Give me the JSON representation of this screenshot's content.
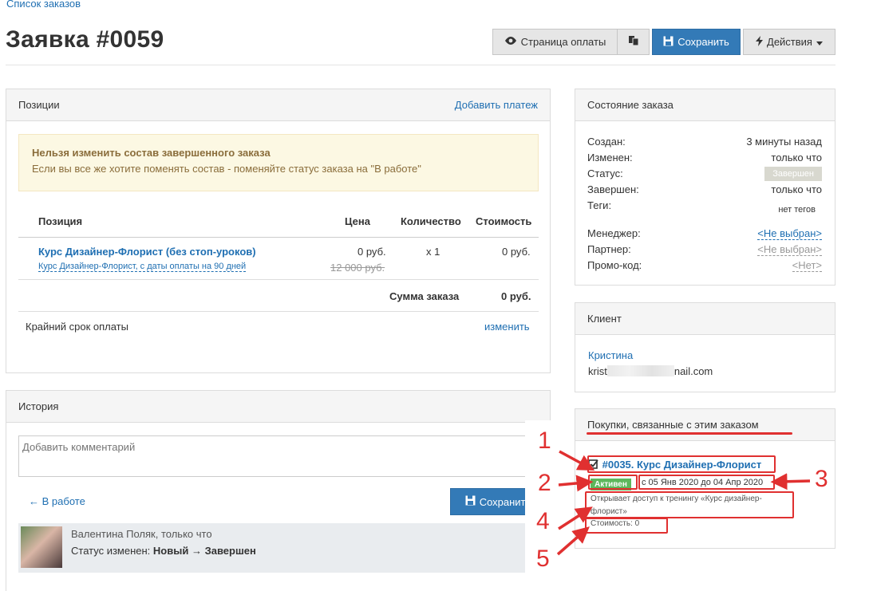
{
  "breadcrumb": "Список заказов",
  "title": "Заявка #0059",
  "toolbar": {
    "payment_page": "Страница оплаты",
    "save": "Сохранить",
    "actions": "Действия"
  },
  "positions": {
    "header": "Позиции",
    "add_payment": "Добавить платеж",
    "alert_title": "Нельзя изменить состав завершенного заказа",
    "alert_text": "Если вы все же хотите поменять состав - поменяйте статус заказа на \"В работе\"",
    "columns": {
      "position": "Позиция",
      "price": "Цена",
      "quantity": "Количество",
      "cost": "Стоимость"
    },
    "item": {
      "name": "Курс Дизайнер-Флорист (без стоп-уроков)",
      "sub": "Курс Дизайнер-Флорист, с даты оплаты на 90 дней",
      "price": "0 руб.",
      "old_price": "12 000 руб.",
      "qty": "x 1",
      "cost": "0 руб."
    },
    "total_label": "Сумма заказа",
    "total_value": "0 руб.",
    "deadline_label": "Крайний срок оплаты",
    "deadline_change": "изменить"
  },
  "history": {
    "header": "История",
    "comment_placeholder": "Добавить комментарий",
    "in_work": "В работе",
    "save": "Сохранить",
    "entry_author": "Валентина Поляк",
    "entry_time": ", только что",
    "entry_status_prefix": "Статус изменен: ",
    "entry_status_from": "Новый",
    "entry_status_to": "Завершен"
  },
  "order_state": {
    "header": "Состояние заказа",
    "created_label": "Создан:",
    "created_value": "3 минуты назад",
    "changed_label": "Изменен:",
    "changed_value": "только что",
    "status_label": "Статус:",
    "status_value": "Завершен",
    "completed_label": "Завершен:",
    "completed_value": "только что",
    "tags_label": "Теги:",
    "tags_value": "нет тегов",
    "manager_label": "Менеджер:",
    "manager_value": "<Не выбран>",
    "partner_label": "Партнер:",
    "partner_value": "<Не выбран>",
    "promo_label": "Промо-код:",
    "promo_value": "<Нет>"
  },
  "client": {
    "header": "Клиент",
    "name": "Кристина",
    "email_start": "krist",
    "email_end": "nail.com"
  },
  "purchases": {
    "header": "Покупки, связанные с этим заказом",
    "title": "#0035. Курс Дизайнер-Флорист",
    "badge": "Активен",
    "dates": "с 05 Янв 2020 до 04 Апр 2020",
    "access": "Открывает доступ к тренингу «Курс дизайнер-флорист»",
    "cost": "Стоимость: 0"
  },
  "annotations": [
    "1",
    "2",
    "3",
    "4",
    "5"
  ],
  "colors": {
    "accent": "#337ab7",
    "annotation": "#e03030",
    "active": "#5cb85c",
    "alert_bg": "#fcf8e3"
  }
}
